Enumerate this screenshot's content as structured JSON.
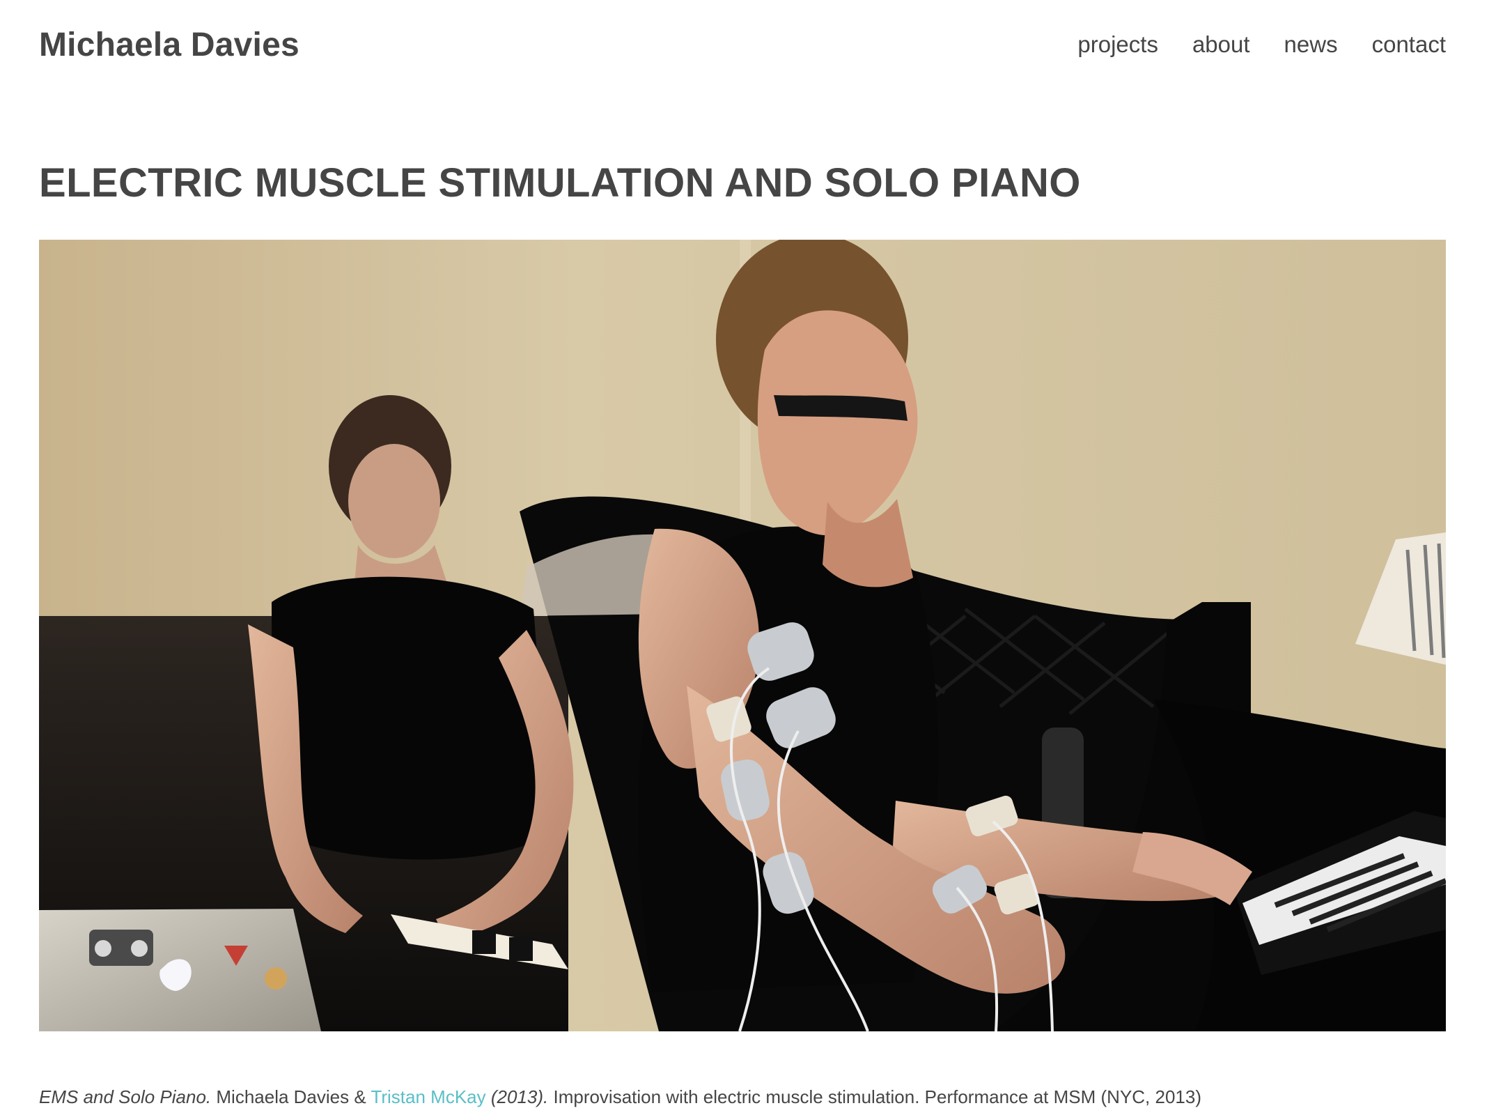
{
  "header": {
    "site_title": "Michaela Davies",
    "nav": [
      {
        "label": "projects"
      },
      {
        "label": "about"
      },
      {
        "label": "news"
      },
      {
        "label": "contact"
      }
    ]
  },
  "page": {
    "title": "ELECTRIC MUSCLE STIMULATION AND SOLO PIANO"
  },
  "media": {
    "photo_name": "performance-photo",
    "colors": {
      "wall": "#d8c9a7",
      "piano": "#0b0b0b",
      "skin": "#d9a98a",
      "electrode": "#c8ccd0",
      "accent_link": "#5abfc7",
      "text": "#454545"
    }
  },
  "caption": {
    "work_title": "EMS and Solo Piano.",
    "artists_prefix": " Michaela Davies & ",
    "collaborator_link": "Tristan McKay",
    "year": " (2013).",
    "description": " Improvisation with electric muscle stimulation. Performance at MSM (NYC, 2013)"
  }
}
